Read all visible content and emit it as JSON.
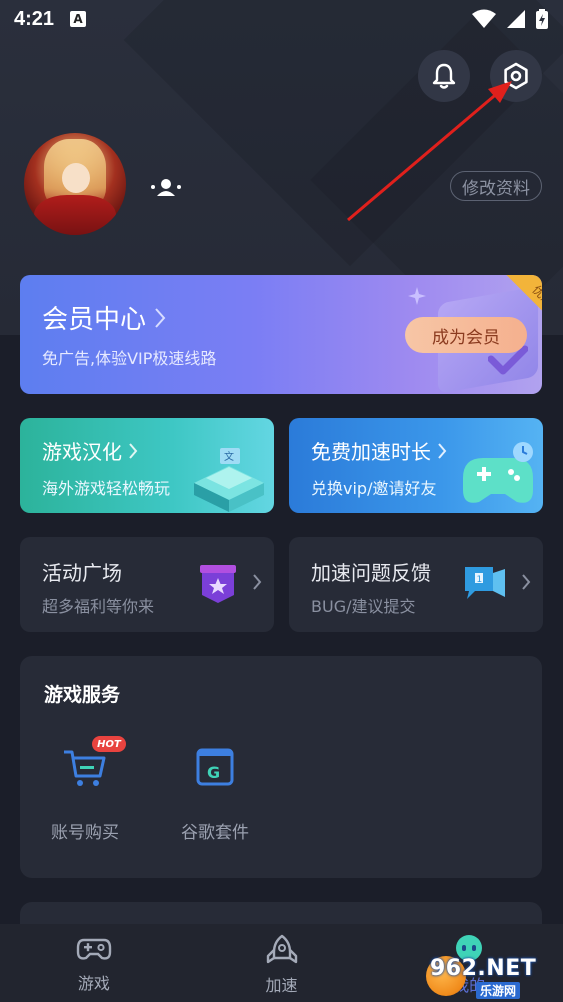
{
  "status_bar": {
    "time": "4:21",
    "notification_glyph": "A"
  },
  "header": {
    "edit_profile_label": "修改资料"
  },
  "vip_card": {
    "title": "会员中心",
    "subtitle": "免广告,体验VIP极速线路",
    "button_label": "成为会员",
    "ribbon_label": "优惠"
  },
  "feature_cards": [
    {
      "title": "游戏汉化",
      "subtitle": "海外游戏轻松畅玩"
    },
    {
      "title": "免费加速时长",
      "subtitle": "兑换vip/邀请好友"
    }
  ],
  "secondary_cards": [
    {
      "title": "活动广场",
      "subtitle": "超多福利等你来"
    },
    {
      "title": "加速问题反馈",
      "subtitle": "BUG/建议提交"
    }
  ],
  "game_service": {
    "title": "游戏服务",
    "items": [
      {
        "label": "账号购买",
        "badge": "HOT",
        "icon": "cart-icon"
      },
      {
        "label": "谷歌套件",
        "icon": "google-suite-icon"
      }
    ]
  },
  "bottom_nav": {
    "items": [
      {
        "label": "游戏",
        "icon": "gamepad-icon"
      },
      {
        "label": "加速",
        "icon": "rocket-icon"
      },
      {
        "label": "我的",
        "icon": "robot-icon",
        "active": true
      }
    ]
  },
  "watermark": {
    "main": "962.NET",
    "sub": "乐游网"
  },
  "colors": {
    "background": "#1b1e29",
    "card": "#272b37",
    "vip_gradient_start": "#5d7ef0",
    "vip_button": "#f5b08e",
    "accent": "#5b6fd6",
    "annotation": "#e0201c"
  }
}
